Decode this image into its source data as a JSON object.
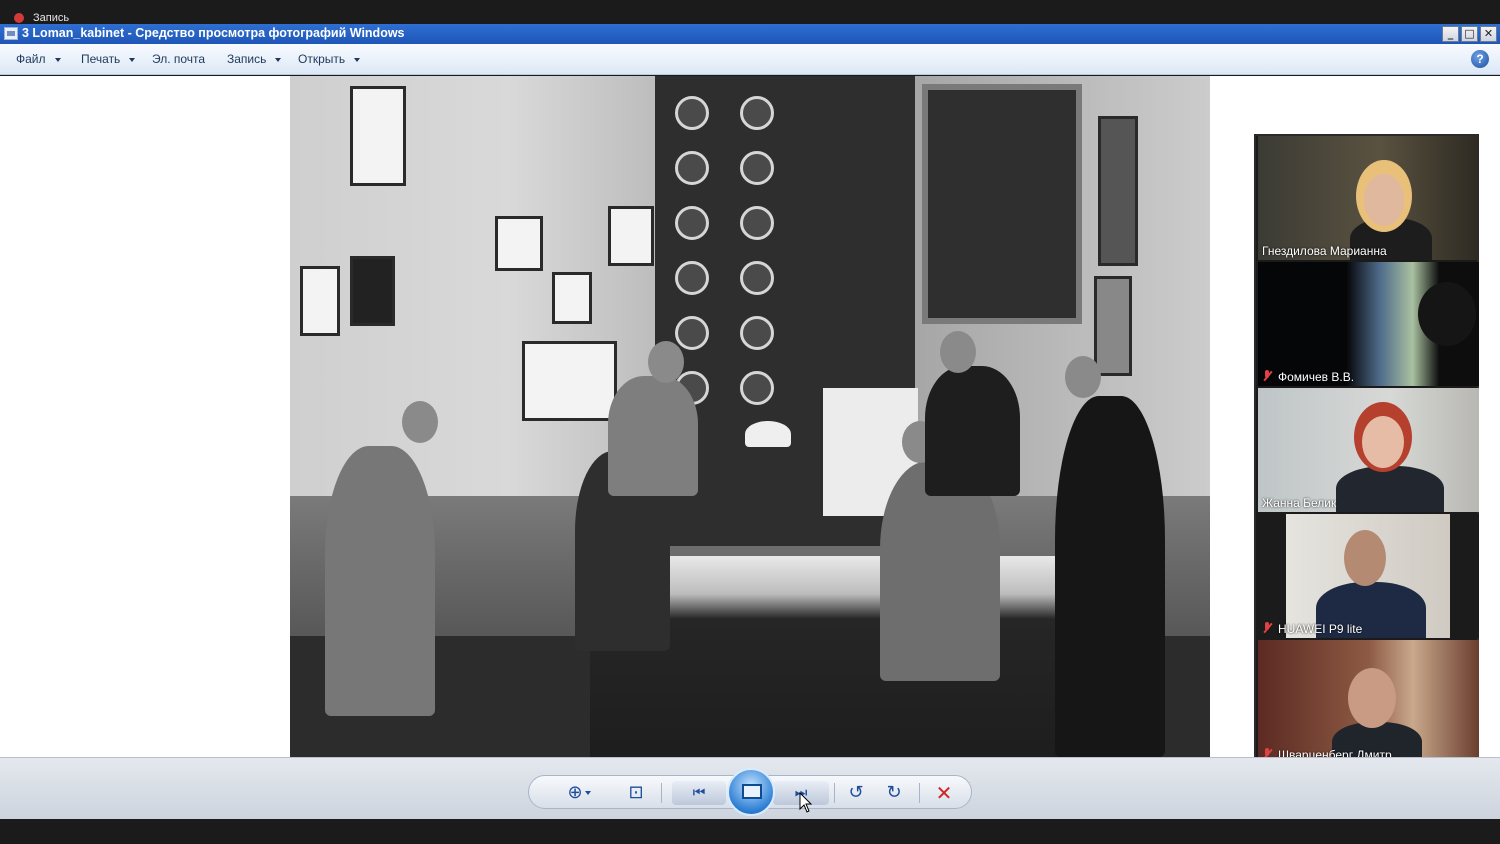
{
  "recording": {
    "label": "Запись"
  },
  "window": {
    "title": "3 Loman_kabinet - Средство просмотра фотографий Windows",
    "controls": {
      "minimize": "_",
      "maximize": "□",
      "close": "✕"
    }
  },
  "menu": {
    "file": "Файл",
    "print": "Печать",
    "email": "Эл. почта",
    "record": "Запись",
    "open": "Открыть",
    "help_glyph": "?"
  },
  "participants": [
    {
      "name": "Гнездилова Марианна",
      "muted": false,
      "active": false
    },
    {
      "name": "Фомичев В.В.",
      "muted": true,
      "active": false
    },
    {
      "name": "Жанна Белик",
      "muted": false,
      "active": true
    },
    {
      "name": "HUAWEI P9 lite",
      "muted": true,
      "active": false
    },
    {
      "name": "Шварценберг Дмитр...",
      "muted": true,
      "active": false
    }
  ],
  "controls": {
    "zoom_glyph": "⊕",
    "fit_glyph": "⊡",
    "prev_glyph": "⏮",
    "next_glyph": "⏭",
    "rotate_left_glyph": "↺",
    "rotate_right_glyph": "↻",
    "delete_glyph": "✕"
  },
  "colors": {
    "titlebar": "#2464c8",
    "active_tile_border": "#7dc66d",
    "mic_off": "#e04343"
  }
}
